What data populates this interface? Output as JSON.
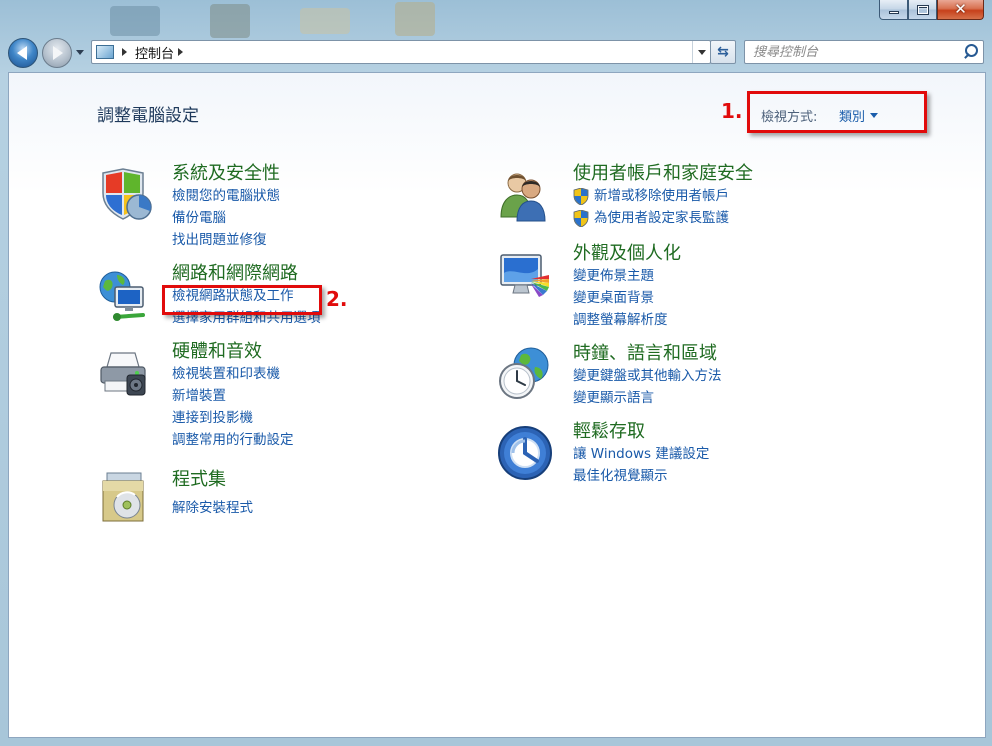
{
  "window": {
    "caption_buttons": {
      "minimize": "minimize-icon",
      "maximize": "maximize-icon",
      "close": "close-icon"
    }
  },
  "nav": {
    "address_path": "控制台",
    "search_placeholder": "搜尋控制台"
  },
  "page": {
    "title": "調整電腦設定",
    "view_by_label": "檢視方式:",
    "view_by_value": "類別"
  },
  "categories_left": [
    {
      "title": "系統及安全性",
      "icon": "system-security-icon",
      "links": [
        "檢閱您的電腦狀態",
        "備份電腦",
        "找出問題並修復"
      ]
    },
    {
      "title": "網路和網際網路",
      "icon": "network-internet-icon",
      "links": [
        "檢視網路狀態及工作",
        "選擇家用群組和共用選項"
      ]
    },
    {
      "title": "硬體和音效",
      "icon": "hardware-sound-icon",
      "links": [
        "檢視裝置和印表機",
        "新增裝置",
        "連接到投影機",
        "調整常用的行動設定"
      ]
    },
    {
      "title": "程式集",
      "icon": "programs-icon",
      "links": [
        "解除安裝程式"
      ]
    }
  ],
  "categories_right": [
    {
      "title": "使用者帳戶和家庭安全",
      "icon": "user-accounts-icon",
      "links": [
        "新增或移除使用者帳戶",
        "為使用者設定家長監護"
      ]
    },
    {
      "title": "外觀及個人化",
      "icon": "appearance-icon",
      "links": [
        "變更佈景主題",
        "變更桌面背景",
        "調整螢幕解析度"
      ]
    },
    {
      "title": "時鐘、語言和區域",
      "icon": "clock-language-icon",
      "links": [
        "變更鍵盤或其他輸入方法",
        "變更顯示語言"
      ]
    },
    {
      "title": "輕鬆存取",
      "icon": "ease-of-access-icon",
      "links": [
        "讓 Windows 建議設定",
        "最佳化視覺顯示"
      ]
    }
  ],
  "annotations": [
    {
      "label": "1.",
      "color": "#e10b0b"
    },
    {
      "label": "2.",
      "color": "#e10b0b"
    }
  ]
}
